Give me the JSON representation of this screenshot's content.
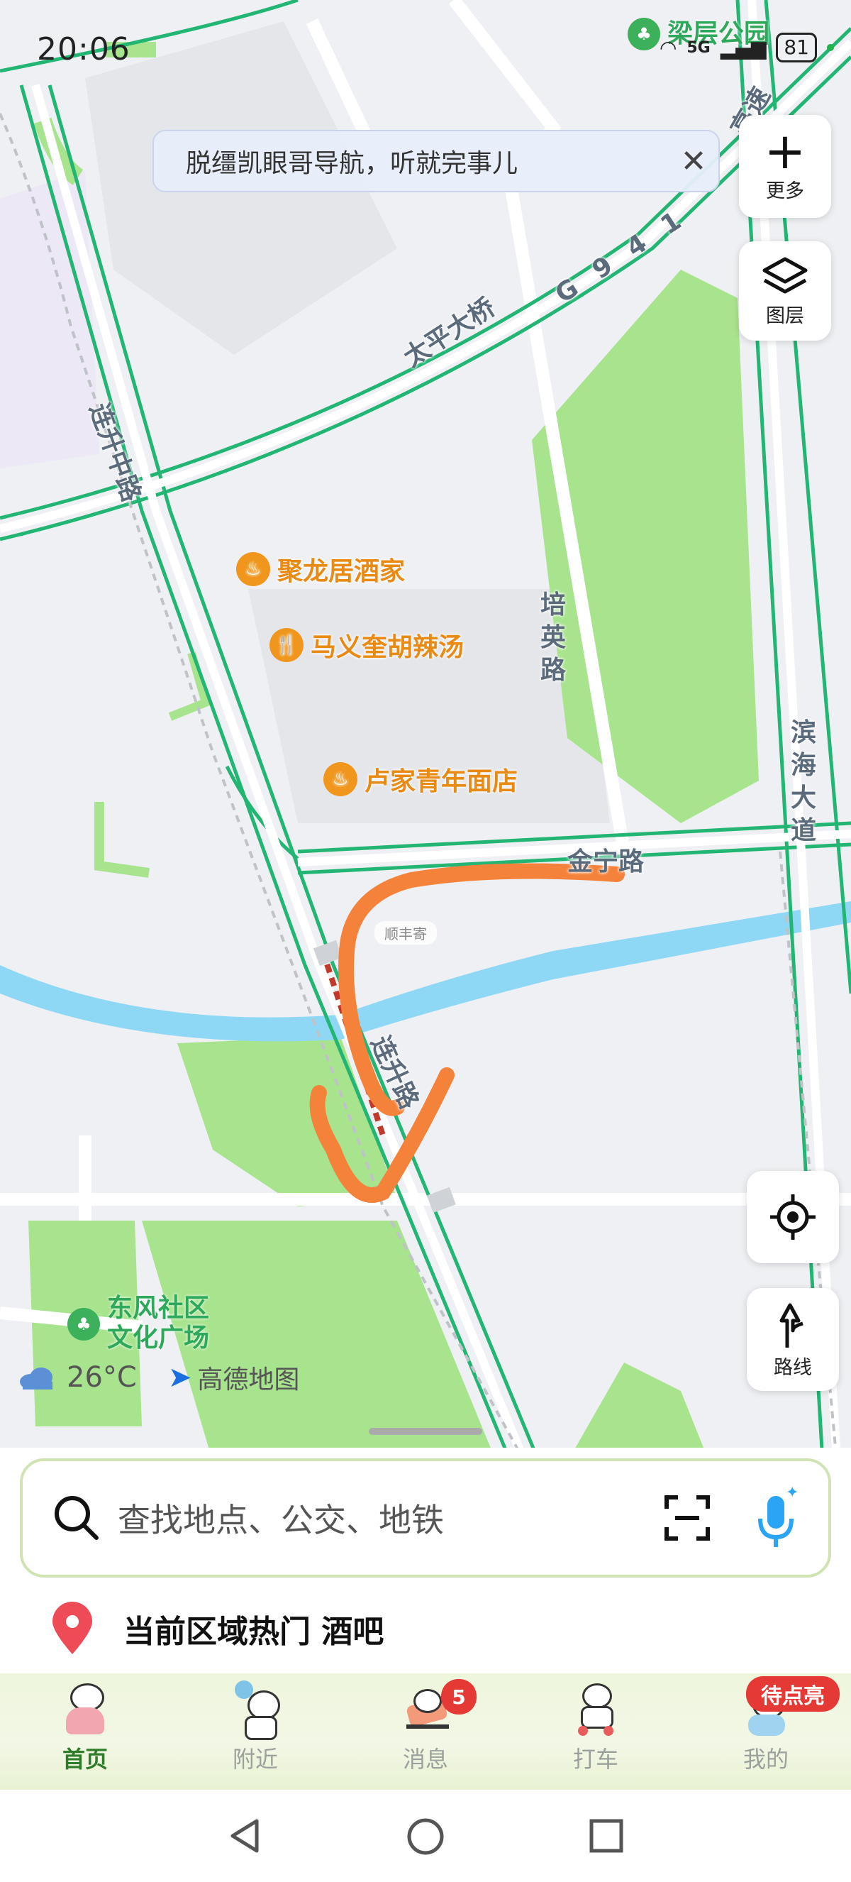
{
  "status_bar": {
    "time": "20:06",
    "network": "5G",
    "battery": "81"
  },
  "banner": {
    "text": "脱缰凯眼哥导航，听就完事儿",
    "close_icon": "close-icon"
  },
  "side_buttons": {
    "more_label": "更多",
    "layers_label": "图层"
  },
  "map": {
    "top_park_label": "梁层公园",
    "roads": [
      "连升中路",
      "太平大桥",
      "G 9 4 1",
      "高速",
      "培英路",
      "滨海大道",
      "金宁路",
      "连升路"
    ],
    "pois": [
      {
        "name": "聚龙居酒家",
        "icon": "restaurant-icon"
      },
      {
        "name": "马义奎胡辣汤",
        "icon": "fork-knife-icon"
      },
      {
        "name": "卢家青年面店",
        "icon": "noodle-icon"
      }
    ],
    "park": "东风社区文化广场",
    "park_lines": [
      "东风社区",
      "文化广场"
    ],
    "label_tag": "顺丰寄"
  },
  "weather": {
    "temperature": "26°C",
    "icon": "cloud-icon"
  },
  "brand": {
    "name": "高德地图"
  },
  "map_controls": {
    "locate_icon": "locate-icon",
    "route_label": "路线"
  },
  "search": {
    "placeholder": "查找地点、公交、地铁"
  },
  "hot": {
    "text": "当前区域热门 酒吧"
  },
  "tabs": [
    {
      "label": "首页",
      "active": true
    },
    {
      "label": "附近",
      "active": false
    },
    {
      "label": "消息",
      "active": false,
      "badge": "5"
    },
    {
      "label": "打车",
      "active": false
    },
    {
      "label": "我的",
      "active": false,
      "badge": "待点亮"
    }
  ],
  "colors": {
    "road_green": "#22b573",
    "park": "#a8e38e",
    "river": "#8fd8f5",
    "poi": "#f0961c",
    "scribble": "#f5823a"
  }
}
